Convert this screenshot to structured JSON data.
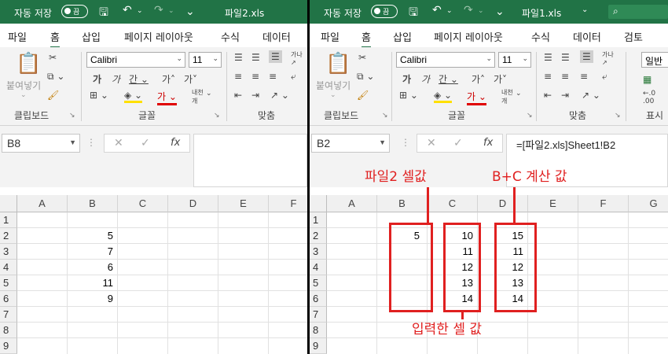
{
  "left": {
    "title": {
      "autosave": "자동 저장",
      "toggle": "끔",
      "filename": "파일2.xls"
    },
    "tabs": [
      "파일",
      "홈",
      "삽입",
      "페이지 레이아웃",
      "수식",
      "데이터"
    ],
    "ribbon": {
      "font_name": "Calibri",
      "font_size": "11",
      "paste_label": "붙여넣기",
      "groups": {
        "clipboard": "클립보드",
        "font": "글꼴",
        "alignment": "맞춤"
      }
    },
    "name_box": "B8",
    "formula": "",
    "columns": [
      "A",
      "B",
      "C",
      "D",
      "E",
      "F"
    ],
    "rows": [
      "1",
      "2",
      "3",
      "4",
      "5",
      "6",
      "7",
      "8",
      "9"
    ],
    "cells_b": [
      "",
      "5",
      "7",
      "6",
      "11",
      "9"
    ]
  },
  "right": {
    "title": {
      "autosave": "자동 저장",
      "toggle": "끔",
      "filename": "파일1.xls"
    },
    "tabs": [
      "파일",
      "홈",
      "삽입",
      "페이지 레이아웃",
      "수식",
      "데이터",
      "검토"
    ],
    "ribbon": {
      "font_name": "Calibri",
      "font_size": "11",
      "paste_label": "붙여넣기",
      "number_format": "일반",
      "groups": {
        "clipboard": "클립보드",
        "font": "글꼴",
        "alignment": "맞춤",
        "number": "표시"
      }
    },
    "name_box": "B2",
    "formula": "=[파일2.xls]Sheet1!B2",
    "columns": [
      "A",
      "B",
      "C",
      "D",
      "E",
      "F",
      "G"
    ],
    "rows": [
      "1",
      "2",
      "3",
      "4",
      "5",
      "6",
      "7",
      "8",
      "9"
    ],
    "cells_b": [
      "",
      "5",
      "",
      "",
      "",
      ""
    ],
    "cells_c": [
      "",
      "10",
      "11",
      "12",
      "13",
      "14"
    ],
    "cells_d": [
      "",
      "15",
      "11",
      "12",
      "13",
      "14"
    ],
    "annotations": {
      "b": "파일2 셀값",
      "d": "B+C 계산 값",
      "c": "입력한 셀 값"
    }
  },
  "colors": {
    "titlebar": "#217346",
    "annotation": "#e02020"
  }
}
